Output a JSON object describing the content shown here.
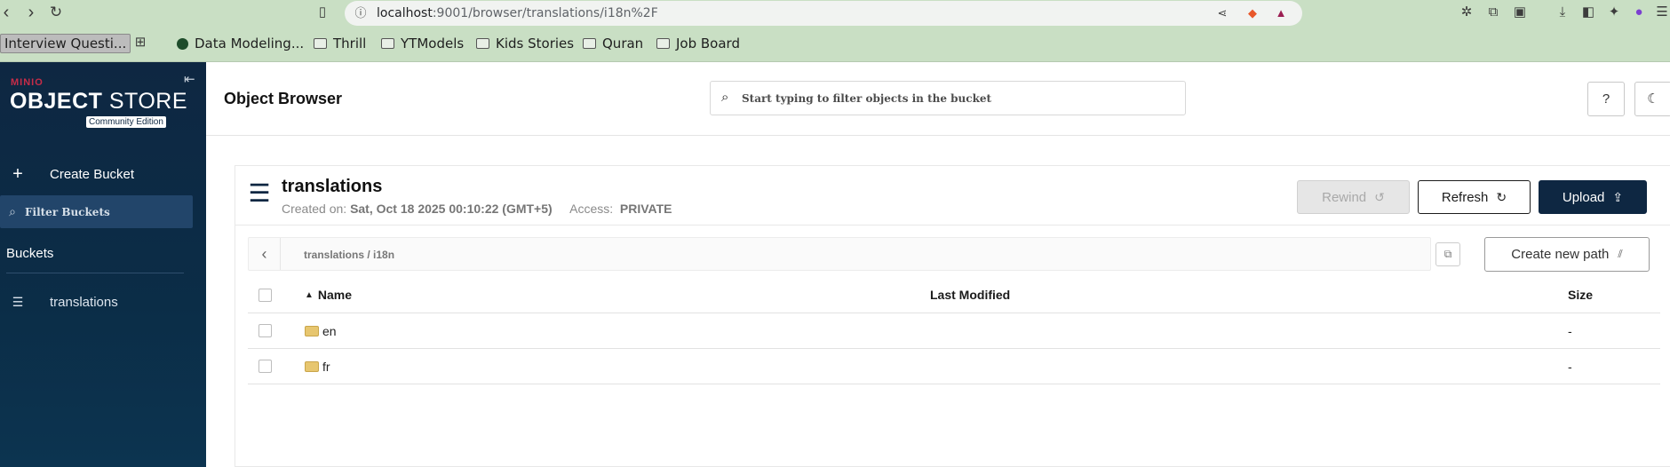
{
  "browser": {
    "url_host": "localhost",
    "url_path": ":9001/browser/translations/i18n%2F",
    "bookmarks": [
      {
        "label": "Interview Questi...",
        "kind": "folder-first"
      },
      {
        "label": "Data Modeling...",
        "kind": "site"
      },
      {
        "label": "Thrill",
        "kind": "folder"
      },
      {
        "label": "YTModels",
        "kind": "folder"
      },
      {
        "label": "Kids Stories",
        "kind": "folder"
      },
      {
        "label": "Quran",
        "kind": "folder"
      },
      {
        "label": "Job Board",
        "kind": "folder"
      }
    ]
  },
  "sidebar": {
    "brand_small": "MINIO",
    "brand_big_bold": "OBJECT",
    "brand_big_light": " STORE",
    "edition": "Community Edition",
    "create_bucket": "Create Bucket",
    "filter_placeholder": "Filter Buckets",
    "buckets_heading": "Buckets",
    "buckets": [
      "translations"
    ]
  },
  "header": {
    "title": "Object Browser",
    "search_placeholder": "Start typing to filter objects in the bucket"
  },
  "bucket": {
    "name": "translations",
    "created_label": "Created on:",
    "created_value": "Sat, Oct 18 2025 00:10:22 (GMT+5)",
    "access_label": "Access:",
    "access_value": "PRIVATE",
    "rewind": "Rewind",
    "refresh": "Refresh",
    "upload": "Upload"
  },
  "path": {
    "breadcrumb": "translations  /  i18n",
    "create_new_path": "Create new path"
  },
  "table": {
    "columns": {
      "name": "Name",
      "modified": "Last Modified",
      "size": "Size"
    },
    "rows": [
      {
        "name": "en",
        "modified": "",
        "size": "-"
      },
      {
        "name": "fr",
        "modified": "",
        "size": "-"
      }
    ]
  }
}
